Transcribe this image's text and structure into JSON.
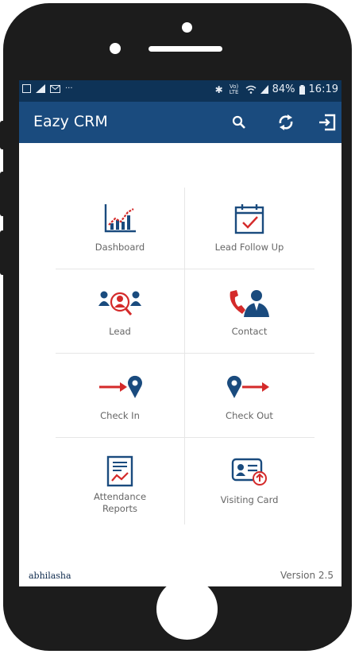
{
  "status_bar": {
    "battery": "84%",
    "time": "16:19",
    "network": "Vo) LTE",
    "icons": [
      "notification-icon",
      "signal-icon",
      "mail-icon",
      "more-icon",
      "bluetooth-icon",
      "wifi-icon",
      "battery-icon"
    ]
  },
  "app_bar": {
    "title": "Eazy CRM",
    "color": "#1a4b7e",
    "actions": [
      "search-icon",
      "sync-icon",
      "logout-icon"
    ]
  },
  "menu": {
    "items": [
      {
        "label": "Dashboard",
        "icon": "line-chart-icon"
      },
      {
        "label": "Lead Follow Up",
        "icon": "calendar-check-icon"
      },
      {
        "label": "Lead",
        "icon": "lead-search-icon"
      },
      {
        "label": "Contact",
        "icon": "contact-phone-icon"
      },
      {
        "label": "Check In",
        "icon": "check-in-icon"
      },
      {
        "label": "Check Out",
        "icon": "check-out-icon"
      },
      {
        "label": "Attendance Reports",
        "line1": "Attendance",
        "line2": "Reports",
        "icon": "attendance-report-icon"
      },
      {
        "label": "Visiting Card",
        "icon": "visiting-card-icon"
      }
    ]
  },
  "footer": {
    "user": "abhilasha",
    "version": "Version 2.5"
  },
  "colors": {
    "accent_red": "#d42a2a",
    "accent_navy": "#1a4b7e"
  }
}
